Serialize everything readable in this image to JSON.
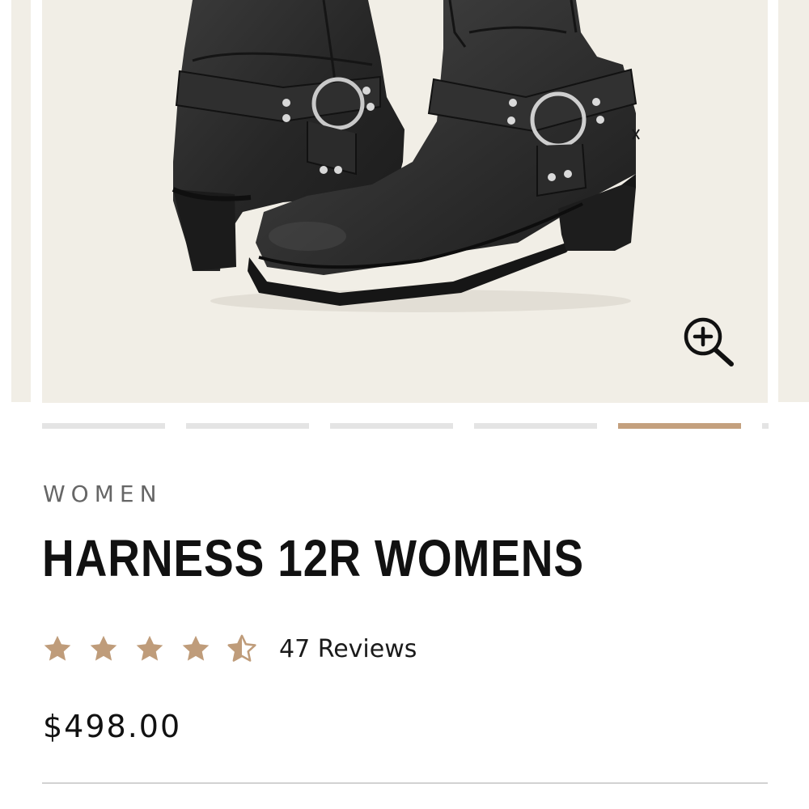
{
  "product": {
    "category": "WOMEN",
    "title": "HARNESS 12R WOMENS",
    "rating_value": 4.5,
    "rating_max": 5,
    "reviews_label": "47 Reviews",
    "price": "$498.00"
  },
  "gallery": {
    "image": "black-harness-boots-photo",
    "zoom_icon": "zoom-in-icon",
    "slide_count": 6,
    "active_slide": 5
  },
  "colors": {
    "accent": "#c4a07e",
    "slide_background": "#f1eee6",
    "pager_inactive": "#e4e4e4",
    "text": "#111111",
    "muted_text": "#666666"
  }
}
